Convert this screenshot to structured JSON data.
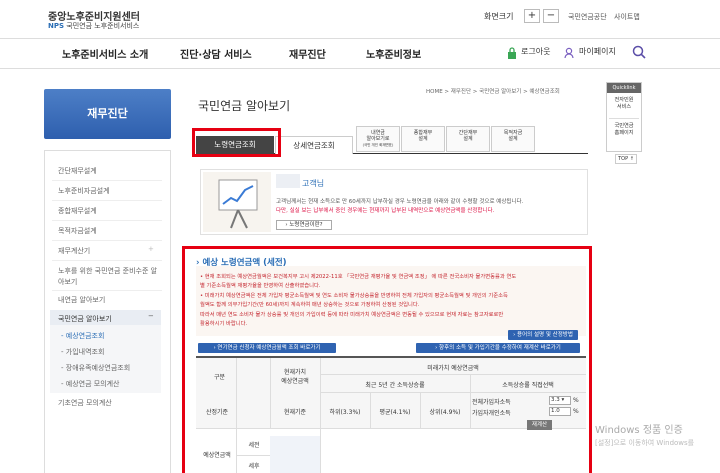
{
  "header": {
    "logo_line1": "중앙노후준비지원센터",
    "logo_nps": "NPS",
    "logo_line2": "국민연금 노후준비서비스",
    "fontsize_label": "화면크기",
    "plus": "+",
    "minus": "−",
    "link1": "국민연금공단",
    "link2": "사이트맵"
  },
  "gnb": [
    "노후준비서비스 소개",
    "진단·상담 서비스",
    "재무진단",
    "노후준비정보"
  ],
  "util": {
    "login": "로그아웃",
    "mypage": "마이페이지"
  },
  "left": {
    "title": "재무진단",
    "items": [
      "간단재무설계",
      "노후준비자금설계",
      "종합재무설계",
      "목적자금설계",
      "재무계산기",
      "노후를 위한 국민연금 준비수준 알",
      "아보기",
      "내연금 알아보기",
      "국민연금 알아보기",
      "- 예상연금조회",
      "- 가입내역조회",
      "- 장애유족예상연금조회",
      "- 예상연금 모의계산",
      "기초연금 모의계산"
    ],
    "plus_sign": "+",
    "minus_sign": "−"
  },
  "content": {
    "title": "국민연금 알아보기",
    "breadcrumb": "HOME  >  재무진단  >  국민연금 알아보기  >  예상연금조회",
    "tabs": [
      "노령연금조회",
      "상세연금조회"
    ],
    "subtabs": [
      [
        "내연금",
        "알아보기로",
        "(국민 개인 화재면표)"
      ],
      [
        "종합재무",
        "설계"
      ],
      [
        "간단재무",
        "설계"
      ],
      [
        "목적자금",
        "설계"
      ]
    ],
    "name_suffix": "고객님",
    "info1": "고객님께서는 현재 소득으로 만 60세까지 납부하실 경우 노령연금을 아래와 같이 수령할 것으로 예상됩니다.",
    "info2": "다만, 실실 보는 납부에서 중인 경우에는 현재까지 납부된 내역만으로 예상연금액을 산정합니다.",
    "info_btn": "› 노령연금이란?",
    "section_title": "› 예상 노령연금액 (세전)",
    "notes": [
      "• 현재 조회되는 예상연금월액은 보건복지부 고시 제2022-11호 「국민연금 재평가율 및 연금액 조정」 에 따른 전국소비자 물가변동률과 연도",
      "  별 기준소득월액 재평가율을 반영하여 산출하였습니다.",
      "• 미래가치 예상연금액은 전체 가입자 평균소득월액 및 연도 소비자 물가상승률을 반영하여 전체 가입자의 평균소득월액 및 개인의 기준소득",
      "  월액도 함께 의무가입기간(만 60세)까지 계속하여 매년 상승하는 것으로 가정하여 산정된 것입니다.",
      "  따라서 매년 연도 소비자 물가 상승률 및 개인의 가입이력 등에 따라 미래가치 예상연금액은 변동될 수 있으므로 현재 자료는 참고자료로만",
      "  활용하시기 바랍니다."
    ],
    "btn_explain": "› 용어의 설명 및 산정방법",
    "btn_compare": "› 연기연금 신청자 예상연금월액 조회 바로가기",
    "btn_income": "› 향후의 소득 및 가입기간을 수정하여 재계산 바로가기",
    "table": {
      "col_gubun": "구분",
      "col_present": "현재가치",
      "col_present2": "예상연금액",
      "col_future": "미래가치 예상연금액",
      "col_5yr": "최근 5년 간 소득상승률",
      "col_direct": "소득상승률 직접선택",
      "row_basis": "산정기준",
      "c_now": "현재기준",
      "c_low": "하위(3.3%)",
      "c_mid": "평균(4.1%)",
      "c_high": "상위(4.9%)",
      "lbl_all": "전체가입자소득",
      "lbl_indiv": "가입자개인소득",
      "sel1": "3.3 ▾",
      "sel2": "1.0",
      "pct": "%",
      "recalc": "재계산",
      "row_amt": "예상연금액",
      "row_pre": "세전",
      "row_post": "세후"
    }
  },
  "quick": {
    "title": "Quicklink",
    "q1": [
      "전자민원",
      "서비스"
    ],
    "q2": [
      "국민연금",
      "홈페이지"
    ],
    "top": "TOP ↑"
  },
  "watermark": {
    "line1": "Windows 정품 인증",
    "line2": "[설정]으로 이동하여 Windows를"
  }
}
